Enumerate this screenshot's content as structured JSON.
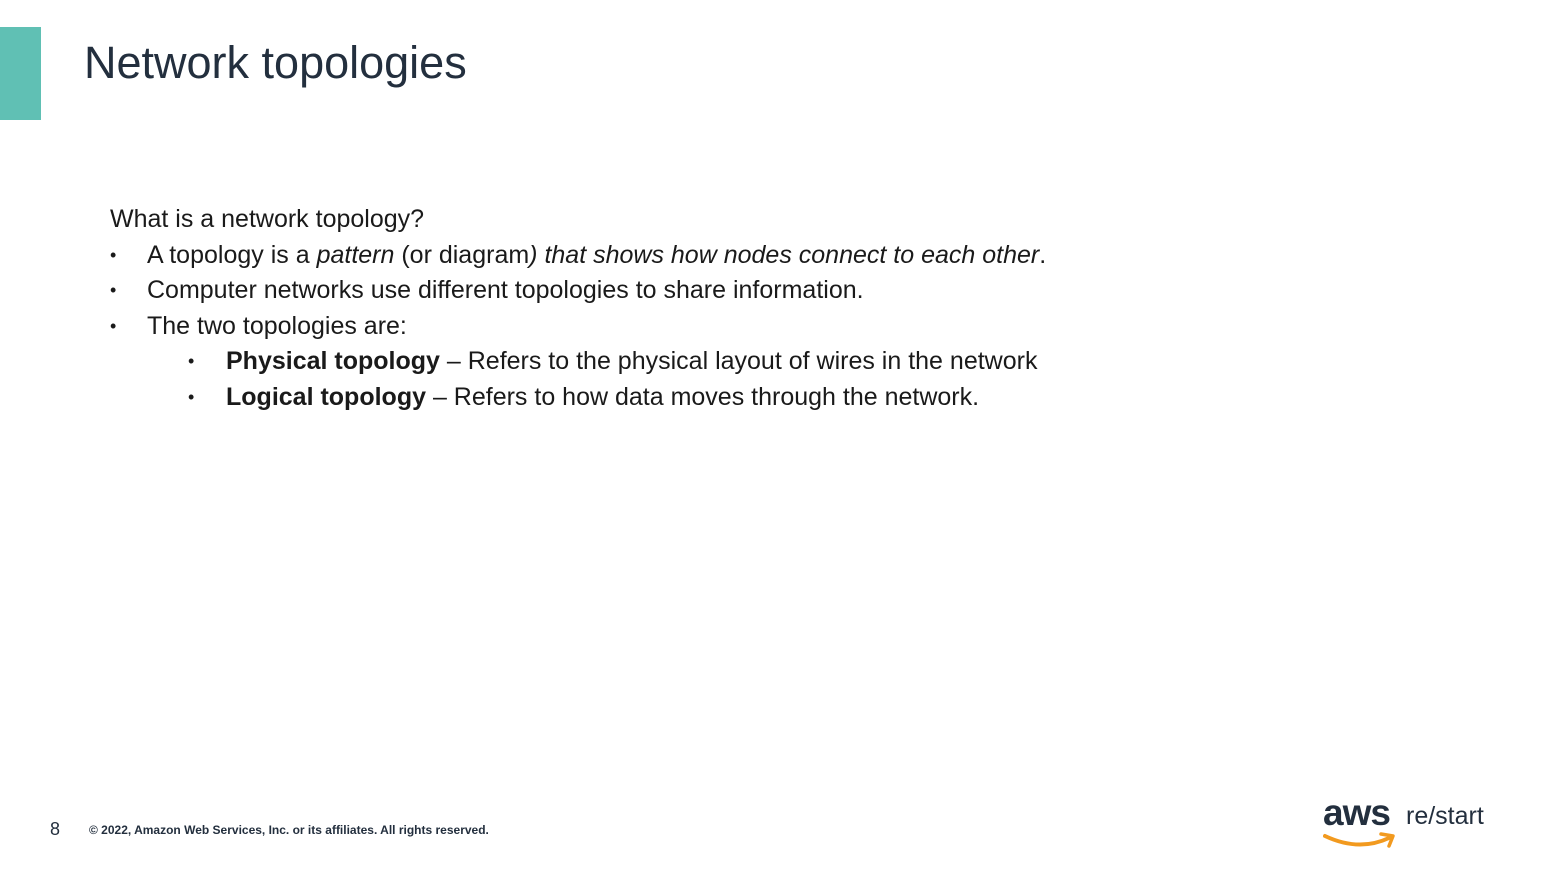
{
  "slide": {
    "title": "Network topologies",
    "accent_color": "#60c0b4"
  },
  "content": {
    "question": "What is a network topology?",
    "bullets": [
      {
        "part1": "A topology is a ",
        "part2_italic": "pattern",
        "part3": " (or diagram",
        "part4_italic": ") that shows how nodes connect to each other",
        "part5": "."
      },
      {
        "text": "Computer networks use different topologies to share information."
      },
      {
        "text": "The two topologies are:"
      }
    ],
    "sub_bullets": [
      {
        "term": "Physical topology",
        "definition": " – Refers to the physical layout of wires in the network"
      },
      {
        "term": "Logical topology",
        "definition": " – Refers to how data moves through the network."
      }
    ],
    "bullet_glyph": "•"
  },
  "footer": {
    "page_number": "8",
    "copyright": "© 2022, Amazon Web Services, Inc. or its affiliates. All rights reserved."
  },
  "logo": {
    "brand": "aws",
    "product": "re/start",
    "smile_color": "#f29a1f",
    "icon": "aws-restart-logo-icon"
  }
}
